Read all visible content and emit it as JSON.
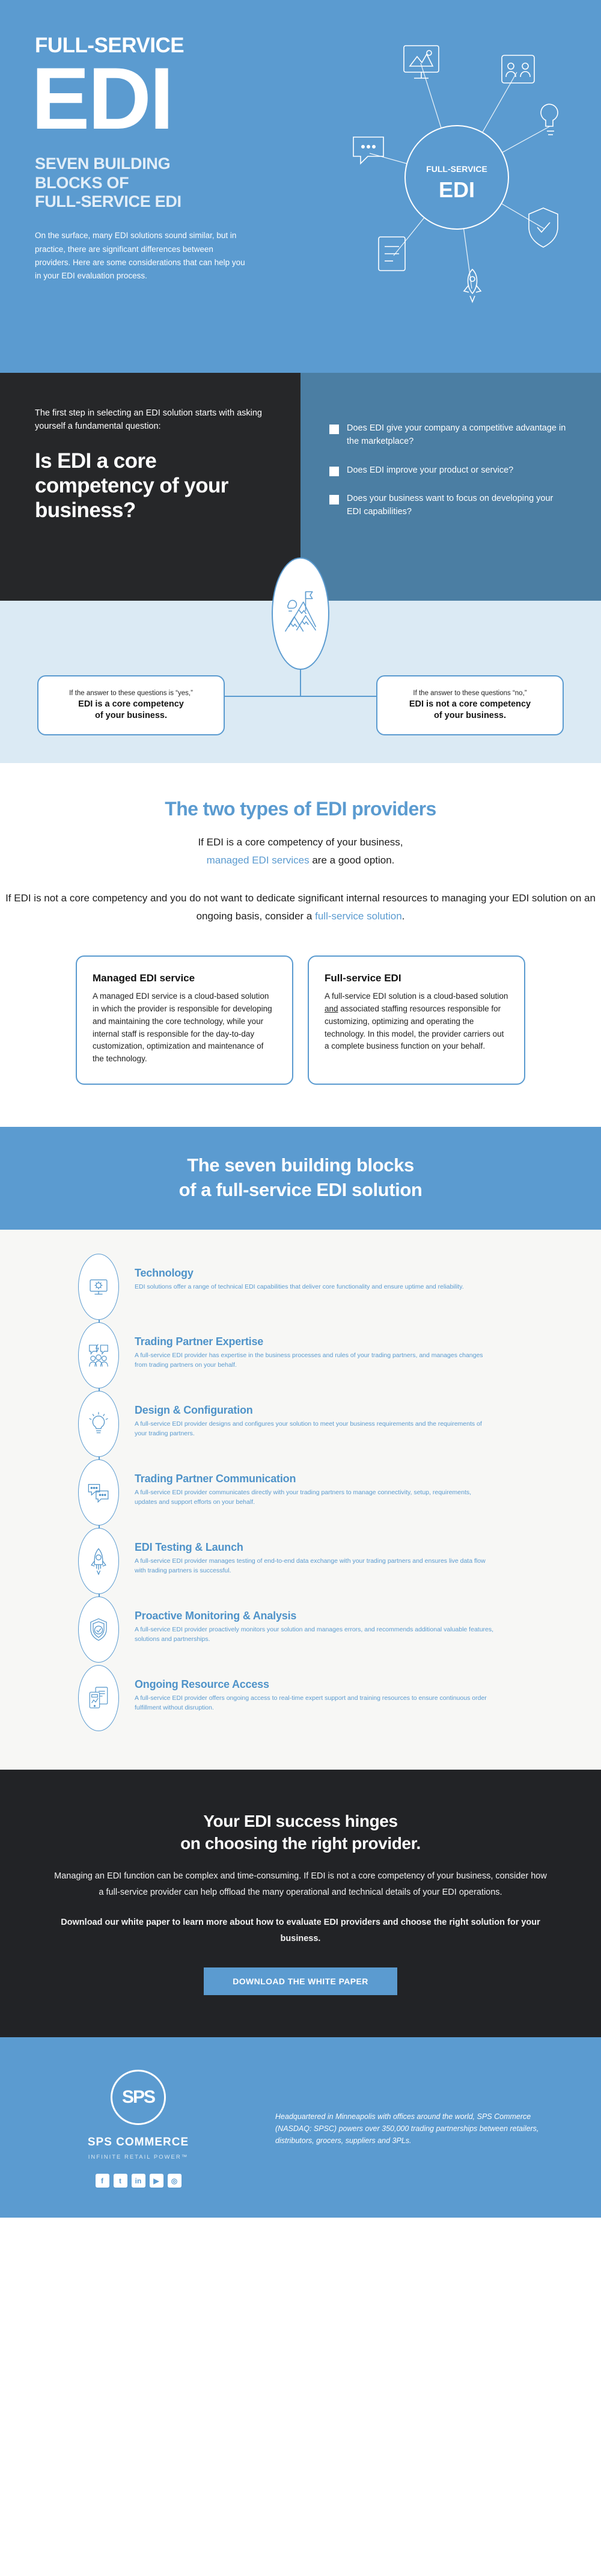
{
  "hero": {
    "kicker": "FULL-SERVICE",
    "title": "EDI",
    "subtitle_line1": "SEVEN BUILDING",
    "subtitle_line2": "BLOCKS OF",
    "subtitle_line3": "FULL-SERVICE EDI",
    "paragraph": "On the surface, many EDI solutions sound similar, but in practice, there are significant differences between providers. Here are some considerations that can help you in your EDI evaluation process.",
    "badge_top": "FULL-SERVICE",
    "badge_bottom": "EDI",
    "accent_color": "#5b9bd0"
  },
  "question_section": {
    "intro": "The first step in selecting an EDI solution starts with asking yourself a fundamental question:",
    "headline": "Is EDI a core competency of your business?",
    "checklist": [
      "Does EDI give your company a competitive advantage in the marketplace?",
      "Does EDI improve your product or service?",
      "Does your business want to focus on developing your EDI capabilities?"
    ],
    "left_bg": "#262729",
    "right_bg": "#4b7ea3"
  },
  "answers": {
    "icon": "mountain-flag-icon",
    "yes": {
      "lead": "If the answer to these questions is “yes,”",
      "strong_line1": "EDI is a core competency",
      "strong_line2": "of your business."
    },
    "no": {
      "lead": "If the answer to these questions “no,”",
      "strong_line1": "EDI is not a core competency",
      "strong_line2": "of your business."
    }
  },
  "types": {
    "heading": "The two types of EDI providers",
    "para1_before": "If EDI is a core competency of your business, ",
    "para1_accent": "managed EDI services",
    "para1_after": " are a good option.",
    "para2_before": "If EDI is not a core competency and you do not want to dedicate significant internal resources to managing your EDI solution on an ongoing basis, consider a ",
    "para2_accent": "full-service solution",
    "para2_after": ".",
    "cards": [
      {
        "title": "Managed EDI service",
        "body": "A managed EDI service is a cloud-based solution in which the provider is responsible for developing and maintaining the core technology, while your internal staff is responsible for the day-to-day customization, optimization and maintenance of the technology."
      },
      {
        "title": "Full-service EDI",
        "body_part1": "A full-service EDI solution is a cloud-based solution ",
        "body_underline": "and",
        "body_part2": " associated staffing resources responsible for customizing, optimizing and operating the technology. In this model, the provider carriers out a complete business function on your behalf."
      }
    ]
  },
  "blocks_banner": {
    "line1": "The seven building blocks",
    "line2": "of a full-service EDI solution"
  },
  "building_blocks": [
    {
      "icon": "monitor-gear-icon",
      "title": "Technology",
      "desc": "EDI solutions offer a range of technical EDI capabilities that deliver core functionality and ensure uptime and reliability."
    },
    {
      "icon": "people-chat-icon",
      "title": "Trading Partner Expertise",
      "desc": "A full-service EDI provider has expertise in the business processes and rules of your trading partners, and manages changes from trading partners on your behalf."
    },
    {
      "icon": "lightbulb-icon",
      "title": "Design & Configuration",
      "desc": "A full-service EDI provider designs and configures your solution to meet your business requirements and the requirements of your trading partners."
    },
    {
      "icon": "speech-bubbles-icon",
      "title": "Trading Partner Communication",
      "desc": "A full-service EDI provider communicates directly with your trading partners to manage connectivity, setup, requirements, updates and support efforts on your behalf."
    },
    {
      "icon": "rocket-icon",
      "title": "EDI Testing & Launch",
      "desc": "A full-service EDI provider manages testing of end-to-end data exchange with your trading partners and ensures live data flow with trading partners is successful."
    },
    {
      "icon": "shield-check-icon",
      "title": "Proactive Monitoring & Analysis",
      "desc": "A full-service EDI provider proactively monitors your solution and manages errors, and recommends additional valuable features, solutions and partnerships."
    },
    {
      "icon": "mobile-report-icon",
      "title": "Ongoing Resource Access",
      "desc": "A full-service EDI provider offers ongoing access to real-time expert support and training resources to ensure continuous order fulfillment without disruption."
    }
  ],
  "cta": {
    "heading_line1": "Your EDI success hinges",
    "heading_line2": "on choosing the right provider.",
    "paragraph1": "Managing an EDI function can be complex and time-consuming. If EDI is not a core competency of your business, consider how a full-service provider can help offload the many operational and technical details of your EDI operations.",
    "paragraph2": "Download our white paper to learn more about how to evaluate EDI providers and choose the right solution for your business.",
    "button_label": "DOWNLOAD THE WHITE PAPER",
    "button_color": "#5b9bd0"
  },
  "footer": {
    "logo_text": "SPS",
    "company": "SPS COMMERCE",
    "tagline": "INFINITE RETAIL POWER™",
    "description": "Headquartered in Minneapolis with offices around the world, SPS Commerce (NASDAQ: SPSC) powers over 350,000 trading partnerships between retailers, distributors, grocers, suppliers and 3PLs.",
    "social": [
      {
        "name": "facebook-icon",
        "glyph": "f"
      },
      {
        "name": "twitter-icon",
        "glyph": "t"
      },
      {
        "name": "linkedin-icon",
        "glyph": "in"
      },
      {
        "name": "youtube-icon",
        "glyph": "▶"
      },
      {
        "name": "instagram-icon",
        "glyph": "◎"
      }
    ]
  }
}
